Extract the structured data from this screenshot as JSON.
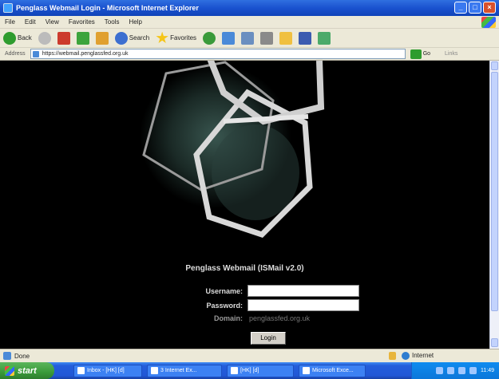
{
  "window": {
    "title": "Penglass Webmail Login - Microsoft Internet Explorer",
    "buttons": [
      "_",
      "□",
      "×"
    ]
  },
  "menu": [
    "File",
    "Edit",
    "View",
    "Favorites",
    "Tools",
    "Help"
  ],
  "toolbar": {
    "back": "Back",
    "search": "Search",
    "favorites": "Favorites"
  },
  "address": {
    "label": "Address",
    "url": "https://webmail.penglassfed.org.uk",
    "go": "Go",
    "links": "Links"
  },
  "page": {
    "heading": "Penglass Webmail (ISMail v2.0)",
    "username_label": "Username:",
    "password_label": "Password:",
    "domain_label": "Domain:",
    "domain_value": "penglassfed.org.uk",
    "login_button": "Login"
  },
  "status": {
    "text": "Done",
    "zone": "Internet"
  },
  "taskbar": {
    "start": "start",
    "tasks": [
      "Inbox - [HK] [d]",
      "3 Internet Ex...",
      "[HK] [d]",
      "Microsoft Exce..."
    ],
    "clock": "11:49"
  }
}
